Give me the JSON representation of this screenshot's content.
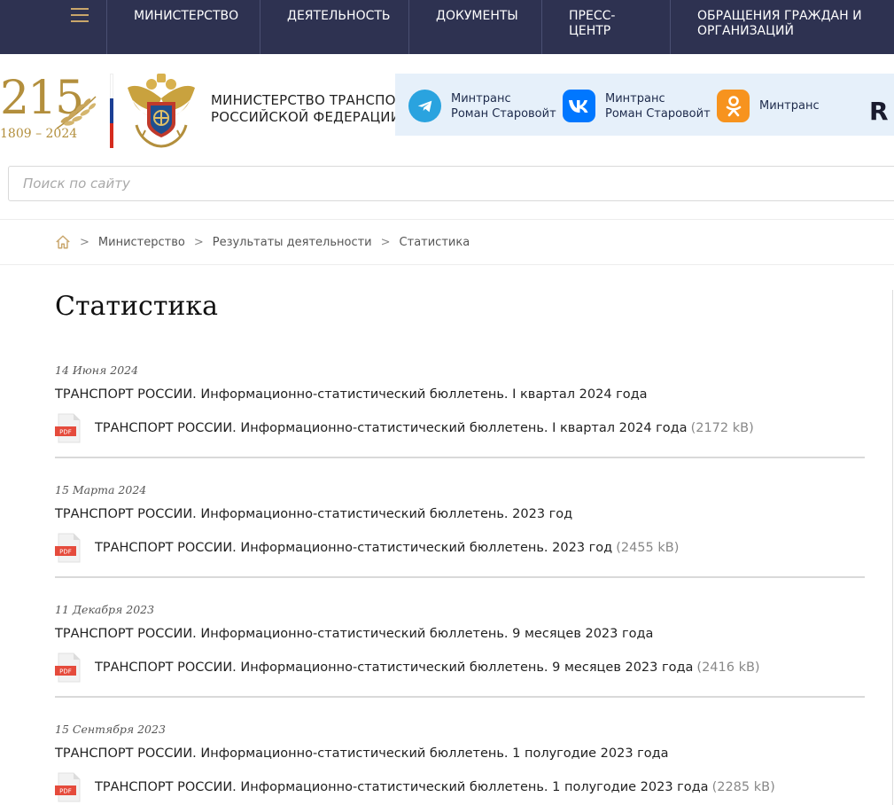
{
  "nav": {
    "items": [
      "Министерство",
      "Деятельность",
      "Документы",
      "Пресс-\nцентр",
      "Обращения граждан и\nорганизаций"
    ]
  },
  "header": {
    "anniversary_number": "215",
    "anniversary_years": "1809 – 2024",
    "ministry_name": "Министерство транспорта\nРоссийской Федерации",
    "flag_colors": [
      "#ffffff",
      "#1c3f94",
      "#d52b1e"
    ],
    "social": [
      {
        "icon": "telegram-icon",
        "color": "#2aa3df",
        "label": "Минтранс\nРоман Старовойт"
      },
      {
        "icon": "vk-icon",
        "color": "#0077ff",
        "label": "Минтранс\nРоман Старовойт"
      },
      {
        "icon": "odnoklassniki-icon",
        "color": "#f7931e",
        "label": "Минтранс"
      }
    ],
    "rutube_label": "R"
  },
  "search": {
    "placeholder": "Поиск по сайту"
  },
  "breadcrumb": {
    "separator": ">",
    "items": [
      "Министерство",
      "Результаты деятельности",
      "Статистика"
    ]
  },
  "page_title": "Статистика",
  "entries": [
    {
      "date": "14 Июня 2024",
      "title": "ТРАНСПОРТ РОССИИ. Информационно-статистический бюллетень. I квартал 2024 года",
      "file_name": "ТРАНСПОРТ РОССИИ. Информационно-статистический бюллетень. I квартал 2024 года",
      "file_size": "(2172 kB)",
      "file_type": "PDF"
    },
    {
      "date": "15 Марта 2024",
      "title": "ТРАНСПОРТ РОССИИ. Информационно-статистический бюллетень. 2023 год",
      "file_name": "ТРАНСПОРТ РОССИИ. Информационно-статистический бюллетень. 2023 год",
      "file_size": "(2455 kB)",
      "file_type": "PDF"
    },
    {
      "date": "11 Декабря 2023",
      "title": "ТРАНСПОРТ РОССИИ. Информационно-статистический бюллетень. 9 месяцев 2023 года",
      "file_name": "ТРАНСПОРТ РОССИИ. Информационно-статистический бюллетень. 9 месяцев 2023 года",
      "file_size": "(2416 kB)",
      "file_type": "PDF"
    },
    {
      "date": "15 Сентября 2023",
      "title": "ТРАНСПОРТ РОССИИ. Информационно-статистический бюллетень. 1 полугодие 2023 года",
      "file_name": "ТРАНСПОРТ РОССИИ. Информационно-статистический бюллетень. 1 полугодие 2023 года",
      "file_size": "(2285 kB)",
      "file_type": "PDF"
    }
  ]
}
